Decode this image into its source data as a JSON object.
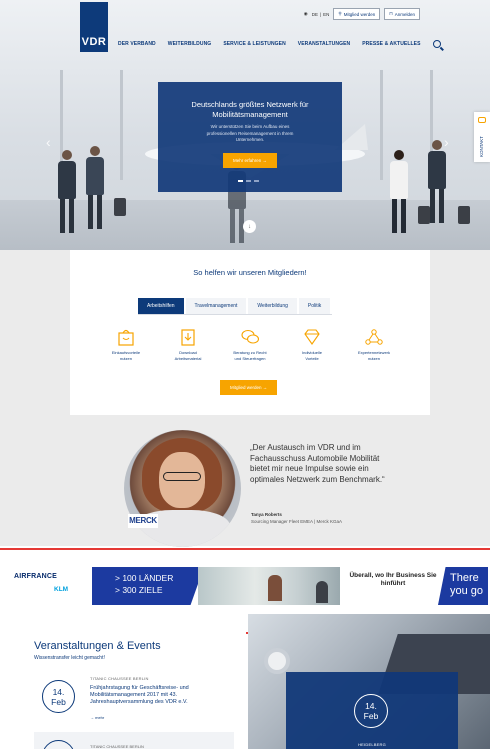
{
  "header": {
    "logo": "VDR",
    "lang_de": "DE",
    "lang_sep": "|",
    "lang_en": "EN",
    "member_button": "Mitglied werden",
    "login_button": "Anmelden",
    "nav": [
      "DER VERBAND",
      "WEITERBILDUNG",
      "SERVICE & LEISTUNGEN",
      "VERANSTALTUNGEN",
      "PRESSE & AKTUELLES"
    ]
  },
  "hero": {
    "title": "Deutschlands größtes Netzwerk für Mobilitätsmanagement",
    "subtitle": "Wir unterstützen Sie beim Aufbau eines professionellen Reisemanagement in Ihrem Unternehmen.",
    "cta": "Mehr erfahren →",
    "prev": "‹",
    "next": "›",
    "scroll": "↓",
    "kontakt": "KONTAKT"
  },
  "help": {
    "title": "So helfen wir unseren Mitgliedern!",
    "tabs": [
      "Arbeitshilfen",
      "Travelmanagement",
      "Weiterbildung",
      "Politik"
    ],
    "features": [
      {
        "icon": "shopping-bag-icon",
        "line1": "Einkaufsvorteile",
        "line2": "nutzen"
      },
      {
        "icon": "download-icon",
        "line1": "Download",
        "line2": "Arbeitsmaterial"
      },
      {
        "icon": "chat-bubbles-icon",
        "line1": "Beratung zu Recht",
        "line2": "und Steuerfragen"
      },
      {
        "icon": "diamond-icon",
        "line1": "Individuelle",
        "line2": "Vorteile"
      },
      {
        "icon": "network-icon",
        "line1": "Expertennetzwerk",
        "line2": "nutzen"
      }
    ],
    "cta": "Mitglied werden →"
  },
  "testimonial": {
    "quote": "„Der Austausch im VDR und im Fachausschuss Automobile Mobilität bietet mir neue Impulse sowie ein optimales Netzwerk zum Benchmark.“",
    "name": "Tanya Roberts",
    "role": "Sourcing Manager Fleet EMEA | Merck KGaA",
    "company_logo": "MERCK"
  },
  "ad": {
    "airline1": "AIRFRANCE",
    "airline2": "KLM",
    "promo_line1": "> 100 LÄNDER",
    "promo_line2": "> 300 ZIELE",
    "slogan": "Überall, wo Ihr Business Sie hinführt",
    "there": "There you go"
  },
  "events": {
    "title": "Veranstaltungen & Events",
    "subtitle": "Wissenstransfer leicht gemacht!",
    "item1": {
      "category": "TITANIC CHAUSSEE BERLIN",
      "day": "14.",
      "month": "Feb",
      "description": "Frühjahrstagung für Geschäftsreise- und Mobilitätsmanagement 2017 mit 43. Jahreshauptversammlung des VDR e.V.",
      "more": "→ mehr"
    },
    "item2": {
      "category": "TITANIC CHAUSSEE BERLIN"
    },
    "featured": {
      "day": "14.",
      "month": "Feb",
      "city": "HEIDELBERG"
    }
  },
  "colors": {
    "brand": "#0d3a7a",
    "accent": "#f7a400",
    "ad_blue": "#1c3aa0",
    "divider": "#e53935"
  }
}
